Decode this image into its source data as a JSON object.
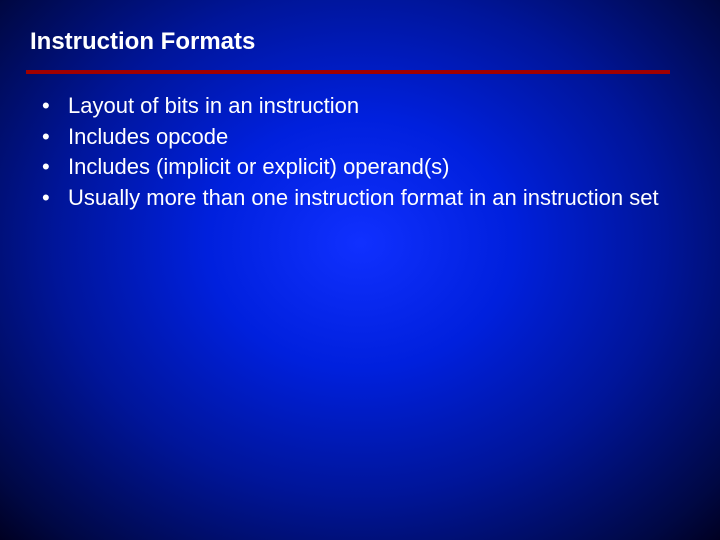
{
  "slide": {
    "title": "Instruction Formats",
    "bullets": [
      "Layout of bits in an instruction",
      "Includes opcode",
      "Includes (implicit or explicit) operand(s)",
      "Usually more than one instruction format in an instruction set"
    ]
  }
}
